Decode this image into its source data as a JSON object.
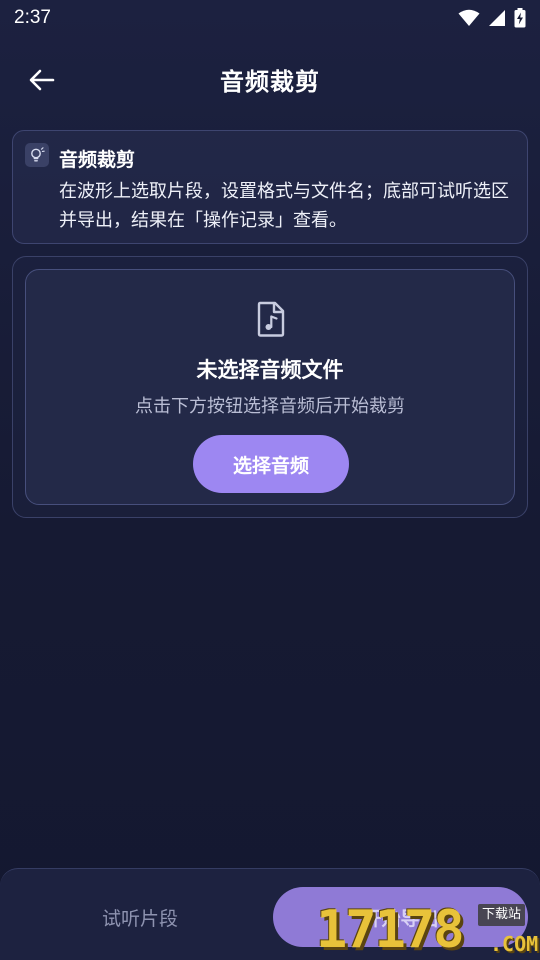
{
  "status_bar": {
    "time": "2:37",
    "icons": [
      "wifi-icon",
      "signal-icon",
      "battery-charging-icon"
    ]
  },
  "app_bar": {
    "back_icon": "arrow-left-icon",
    "title": "音频裁剪"
  },
  "info_card": {
    "icon": "lightbulb-icon",
    "title": "音频裁剪",
    "description": "在波形上选取片段，设置格式与文件名；底部可试听选区并导出，结果在「操作记录」查看。"
  },
  "empty_state": {
    "icon": "music-file-icon",
    "title": "未选择音频文件",
    "description": "点击下方按钮选择音频后开始裁剪",
    "choose_button": "选择音频"
  },
  "bottom_bar": {
    "preview_button": "试听片段",
    "export_button": "开始导出"
  },
  "watermark": {
    "digits": "17178",
    "tag": "下载站",
    "suffix": ".COM"
  },
  "colors": {
    "background": "#181c36",
    "accent": "#9d87f2",
    "card_border": "#3e4570"
  }
}
